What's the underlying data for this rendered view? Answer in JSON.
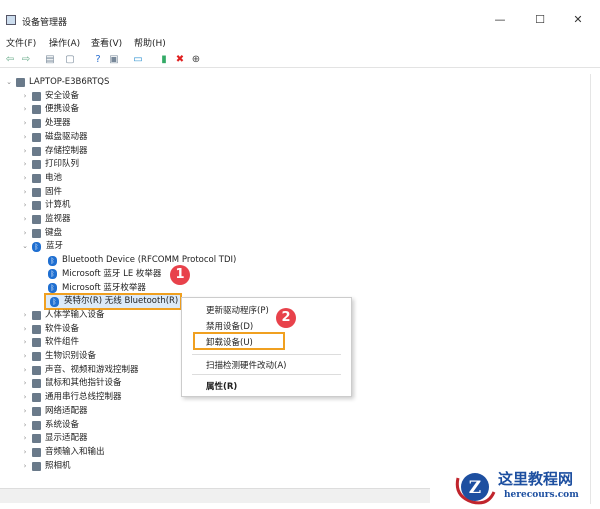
{
  "window": {
    "title": "设备管理器",
    "minimize": "—",
    "maximize": "☐",
    "close": "✕"
  },
  "menu": [
    "文件(F)",
    "操作(A)",
    "查看(V)",
    "帮助(H)"
  ],
  "toolbar": [
    {
      "icon": "back-icon",
      "glyph": "⇦",
      "color": "#6a8"
    },
    {
      "icon": "forward-icon",
      "glyph": "⇨",
      "color": "#6a8"
    },
    {
      "icon": "properties-icon",
      "glyph": "▤",
      "color": "#789"
    },
    {
      "icon": "page-icon",
      "glyph": "▢",
      "color": "#789"
    },
    {
      "icon": "help-icon",
      "glyph": "?",
      "color": "#2a6fd0"
    },
    {
      "icon": "view-icon",
      "glyph": "▣",
      "color": "#789"
    },
    {
      "icon": "monitor-scan-icon",
      "glyph": "▭",
      "color": "#2a8fd0"
    },
    {
      "icon": "add-driver-icon",
      "glyph": "▮",
      "color": "#3a6"
    },
    {
      "icon": "uninstall-icon",
      "glyph": "✖",
      "color": "#e02020"
    },
    {
      "icon": "download-icon",
      "glyph": "⊕",
      "color": "#444"
    }
  ],
  "tree": {
    "root": "LAPTOP-E3B6RTQS",
    "before": [
      "安全设备",
      "便携设备",
      "处理器",
      "磁盘驱动器",
      "存储控制器",
      "打印队列",
      "电池",
      "固件",
      "计算机",
      "监视器",
      "键盘"
    ],
    "bluetooth": {
      "label": "蓝牙",
      "children": [
        "Bluetooth Device (RFCOMM Protocol TDI)",
        "Microsoft 蓝牙 LE 枚举器",
        "Microsoft 蓝牙枚举器",
        "英特尔(R) 无线 Bluetooth(R)"
      ]
    },
    "after": [
      "人体学输入设备",
      "软件设备",
      "软件组件",
      "生物识别设备",
      "声音、视频和游戏控制器",
      "鼠标和其他指针设备",
      "通用串行总线控制器",
      "网络适配器",
      "系统设备",
      "显示适配器",
      "音频输入和输出",
      "照相机"
    ]
  },
  "context_menu": [
    "更新驱动程序(P)",
    "禁用设备(D)",
    "卸载设备(U)",
    "扫描检测硬件改动(A)",
    "属性(R)"
  ],
  "steps": [
    "1",
    "2"
  ],
  "watermark": {
    "name": "这里教程网",
    "url": "herecours.com",
    "letter": "Z"
  },
  "colors": {
    "highlight": "#f0a020",
    "badge": "#e8424b",
    "bluetooth": "#1f6fd1"
  }
}
